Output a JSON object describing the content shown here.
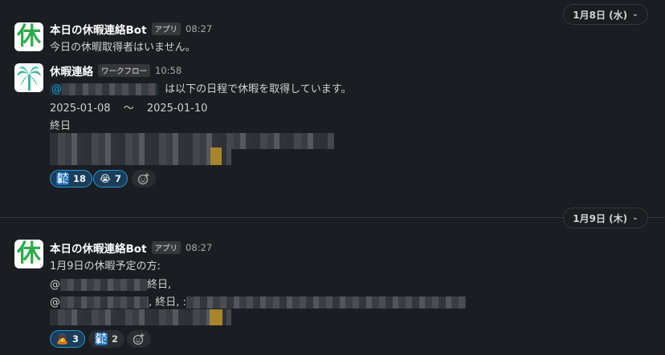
{
  "days": [
    {
      "date_label": "1月8日 (水)",
      "messages": [
        {
          "sender": "本日の休暇連絡Bot",
          "tag": "アプリ",
          "time": "08:27",
          "avatar_char": "休",
          "lines": [
            "今日の休暇取得者はいません。"
          ]
        },
        {
          "sender": "休暇連絡",
          "tag": "ワークフロー",
          "time": "10:58",
          "mention": "@",
          "line1_rest": "は以下の日程で休暇を取得しています。",
          "start": "2025-01-08",
          "tilde": "〜",
          "end": "2025-01-10",
          "allday": "終日",
          "reactions": [
            {
              "emoji_text": "お大事に",
              "count": "18",
              "active": true
            },
            {
              "emoji_text": "😭",
              "count": "7",
              "active": true
            }
          ]
        }
      ]
    },
    {
      "date_label": "1月9日 (木)",
      "messages": [
        {
          "sender": "本日の休暇連絡Bot",
          "tag": "アプリ",
          "time": "08:27",
          "avatar_char": "休",
          "line1": "1月9日の休暇予定の方:",
          "line2_prefix": "@",
          "line2_suffix": "終日,",
          "line3_prefix": "@",
          "line3_suffix": ", 終日, :",
          "reactions": [
            {
              "emoji_text": "🙇",
              "count": "3",
              "active": true
            },
            {
              "emoji_text": "お大事に",
              "count": "2",
              "active": false
            }
          ]
        }
      ]
    }
  ],
  "colors": {
    "bg": "#1a1d21",
    "mention": "#1d9bd1",
    "reaction_active": "#1d3c5a",
    "avatar_green": "#2bac4a"
  },
  "icons": [
    "chevron-down-icon",
    "add-reaction-icon",
    "palm-tree-icon"
  ]
}
